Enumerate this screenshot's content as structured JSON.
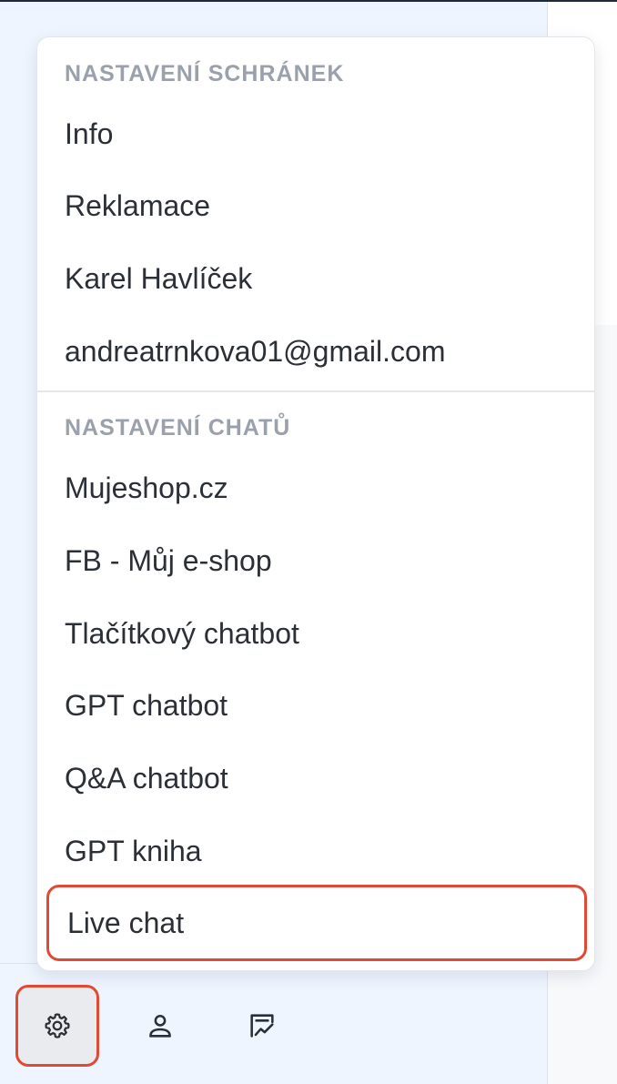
{
  "menu": {
    "mailbox_section": {
      "header": "NASTAVENÍ SCHRÁNEK",
      "items": [
        "Info",
        "Reklamace",
        "Karel Havlíček",
        "andreatrnkova01@gmail.com"
      ]
    },
    "chat_section": {
      "header": "NASTAVENÍ CHATŮ",
      "items": [
        "Mujeshop.cz",
        "FB - Můj e-shop",
        "Tlačítkový chatbot",
        "GPT chatbot",
        "Q&A chatbot",
        "GPT kniha",
        "Live chat"
      ]
    },
    "highlighted_item": "Live chat"
  },
  "bottom_bar": {
    "icons": [
      "gear-icon",
      "user-icon",
      "chart-icon"
    ],
    "active_icon": "gear-icon"
  },
  "colors": {
    "highlight": "#e04a34",
    "panel_background": "#eef5ff",
    "header_text": "#9aa1ac",
    "item_text": "#2b2f36"
  }
}
